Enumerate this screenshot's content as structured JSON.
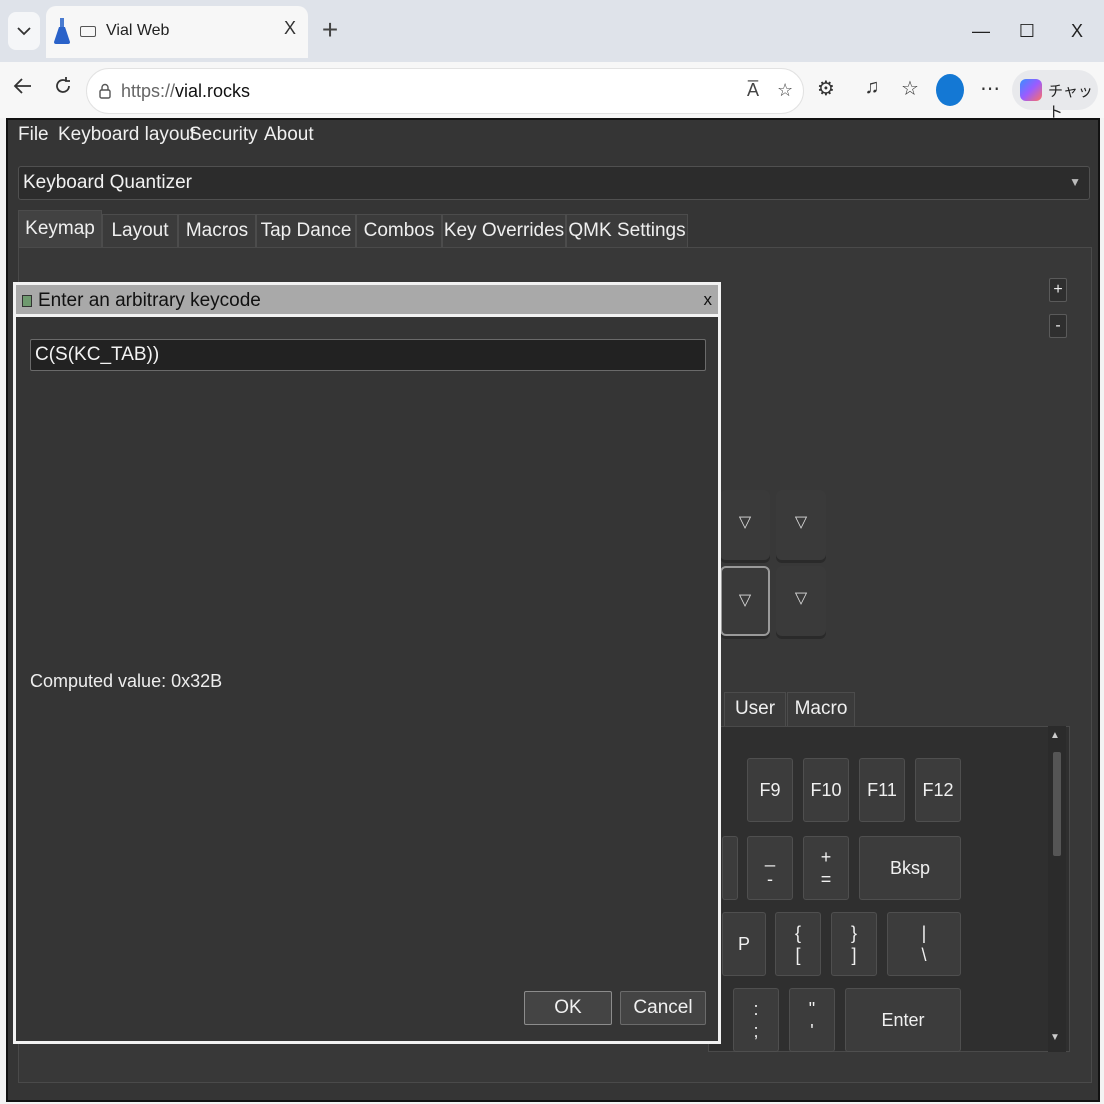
{
  "browser": {
    "tab_title": "Vial Web",
    "tab_close": "X",
    "new_tab": "+",
    "url_scheme": "https://",
    "url_host": "vial.rocks",
    "read_aloud": "A̅",
    "copilot_label": "チャット",
    "window": {
      "minimize": "—",
      "maximize": "☐",
      "close": "X"
    }
  },
  "menubar": [
    "File",
    "Keyboard layout",
    "Security",
    "About"
  ],
  "keyboard_select": {
    "value": "Keyboard Quantizer"
  },
  "main_tabs": [
    "Keymap",
    "Layout",
    "Macros",
    "Tap Dance",
    "Combos",
    "Key Overrides",
    "QMK Settings"
  ],
  "zoom": {
    "plus": "+",
    "minus": "-"
  },
  "layout_keys": [
    "▽",
    "▽",
    "▽",
    "▽"
  ],
  "sub_tabs": [
    "User",
    "Macro"
  ],
  "keypanel": {
    "f_keys": [
      "F9",
      "F10",
      "F11",
      "F12"
    ],
    "row2": [
      {
        "top": "_",
        "bottom": "-"
      },
      {
        "top": "+",
        "bottom": "="
      },
      {
        "top": "Bksp",
        "bottom": ""
      }
    ],
    "row3": [
      {
        "top": "P",
        "bottom": ""
      },
      {
        "top": "{",
        "bottom": "["
      },
      {
        "top": "}",
        "bottom": "]"
      },
      {
        "top": "|",
        "bottom": "\\"
      }
    ],
    "row4": [
      {
        "top": ":",
        "bottom": ";"
      },
      {
        "top": "\"",
        "bottom": "'"
      },
      {
        "top": "Enter",
        "bottom": ""
      }
    ]
  },
  "dialog": {
    "title": "Enter an arbitrary keycode",
    "close": "x",
    "input_value": "C(S(KC_TAB))",
    "computed": "Computed value: 0x32B",
    "ok": "OK",
    "cancel": "Cancel"
  }
}
